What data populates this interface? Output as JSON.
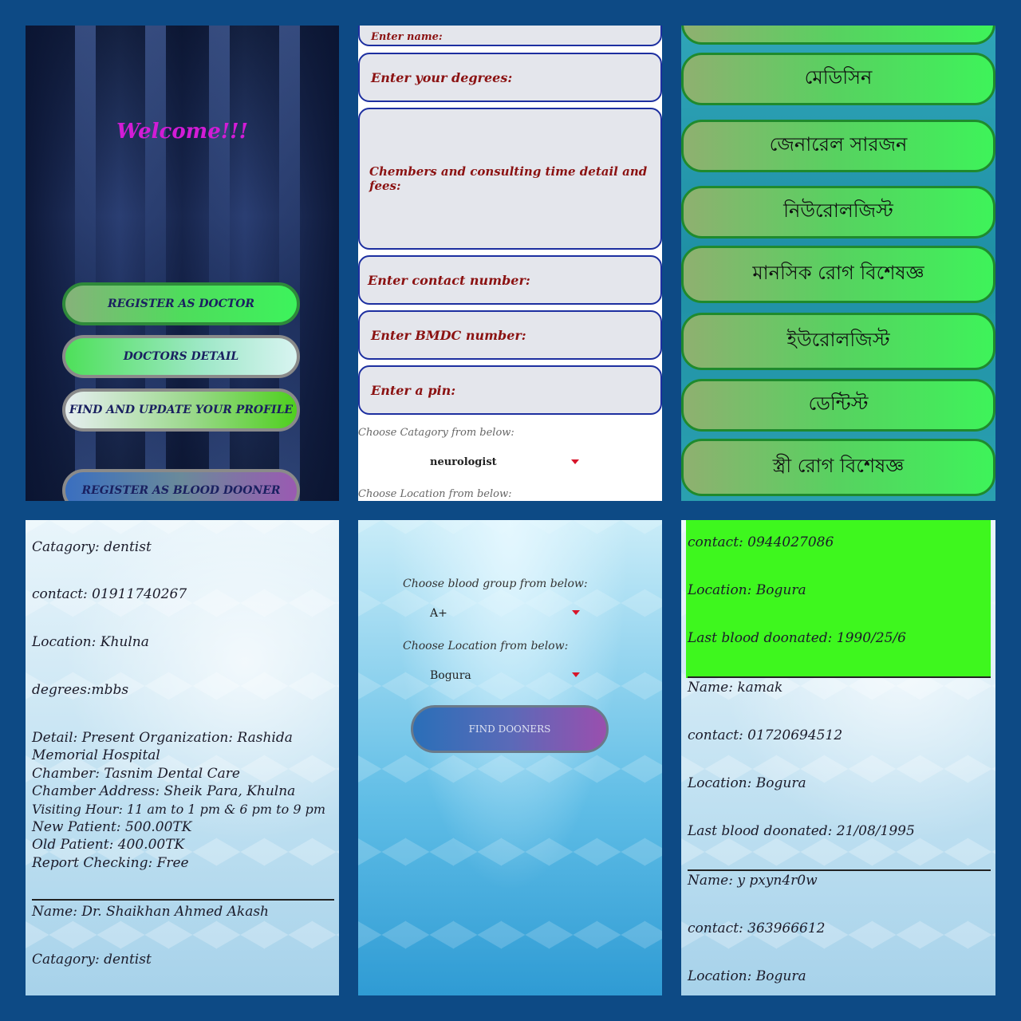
{
  "welcome_screen": {
    "title": "Welcome!!!",
    "buttons": [
      "REGISTER AS DOCTOR",
      "DOCTORS DETAIL",
      "FIND AND UPDATE YOUR PROFILE",
      "REGISTER AS BLOOD DOONER"
    ]
  },
  "register_form": {
    "fields": {
      "name_placeholder": "Enter name:",
      "degrees_placeholder": "Enter your degrees:",
      "chambers_placeholder": "Chembers and consulting time detail and fees:",
      "contact_placeholder": "Enter contact number:",
      "bmdc_placeholder": "Enter BMDC number:",
      "pin_placeholder": "Enter a pin:"
    },
    "category_label": "Choose Catagory from below:",
    "category_value": "neurologist",
    "location_label": "Choose Location from below:"
  },
  "category_list": {
    "items": [
      "মেডিসিন",
      "জেনারেল সারজন",
      "নিউরোলজিস্ট",
      "মানসিক রোগ বিশেষজ্ঞ",
      "ইউরোলজিস্ট",
      "ডেন্টিস্ট",
      "স্ত্রী রোগ বিশেষজ্ঞ"
    ]
  },
  "doctor_detail": {
    "category": "Catagory: dentist",
    "contact": "contact: 01911740267",
    "location": "Location: Khulna",
    "degrees": "degrees:mbbs",
    "detail_lines": [
      "Detail: Present Organization: Rashida",
      "Memorial Hospital",
      "Chamber: Tasnim Dental Care",
      "Chamber Address: Sheik Para, Khulna",
      "Visiting Hour: 11 am to 1 pm & 6 pm to 9 pm",
      "New Patient: 500.00TK",
      "Old Patient: 400.00TK",
      "Report Checking: Free"
    ],
    "next_name": "Name: Dr. Shaikhan Ahmed Akash",
    "next_category": "Catagory: dentist"
  },
  "blood_search": {
    "group_label": "Choose blood group from below:",
    "group_value": "A+",
    "location_label": "Choose Location from below:",
    "location_value": "Bogura",
    "button": "FIND DOONERS"
  },
  "donor_list": {
    "first": {
      "contact": "contact: 0944027086",
      "location": "Location: Bogura",
      "last_donated": "Last blood doonated: 1990/25/6"
    },
    "second": {
      "name": "Name: kamak",
      "contact": "contact: 01720694512",
      "location": "Location: Bogura",
      "last_donated": "Last blood doonated: 21/08/1995"
    },
    "third": {
      "name": "Name: y pxyn4r0w",
      "contact": "contact: 363966612",
      "location": "Location: Bogura"
    }
  },
  "colors": {
    "page_bg": "#0d4a85",
    "button_green": "#3ef35a",
    "highlight_green": "#3ef71e",
    "welcome_magenta": "#d21cd6",
    "form_label": "#8b1212",
    "form_border": "#1d2fa0",
    "dropdown_arrow": "#d7152a"
  }
}
